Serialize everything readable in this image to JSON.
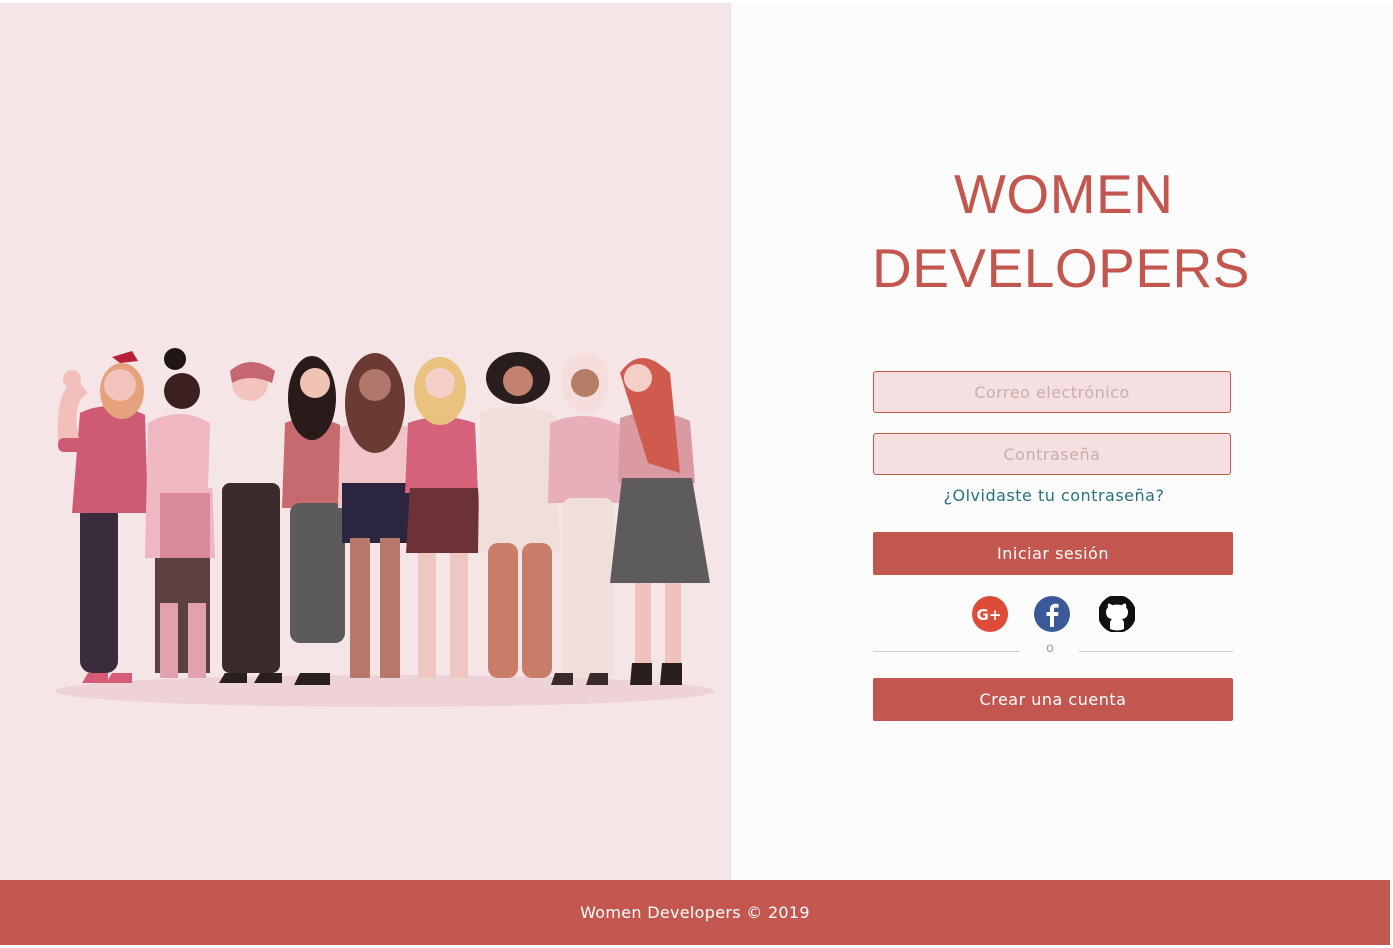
{
  "brand": {
    "title_line_1": "WOMEN",
    "title_line_2": "DEVELOPERS"
  },
  "login_form": {
    "email_placeholder": "Correo electrónico",
    "email_value": "",
    "password_placeholder": "Contraseña",
    "password_value": "",
    "forgot_password_link": "¿Olvidaste tu contraseña?",
    "login_button": "Iniciar sesión",
    "social_icons": [
      "google-plus-icon",
      "facebook-icon",
      "github-icon"
    ],
    "divider_text": "o",
    "register_button": "Crear una cuenta"
  },
  "footer": {
    "text": "Women Developers © 2019"
  },
  "colors": {
    "accent": "#c3574f",
    "left_background": "#f5e5e6",
    "right_background": "#fcfcfc",
    "input_background": "#f5dfe0",
    "link": "#2a6f7e",
    "google": "#dd4b39",
    "facebook": "#3b5998",
    "github": "#111111"
  }
}
